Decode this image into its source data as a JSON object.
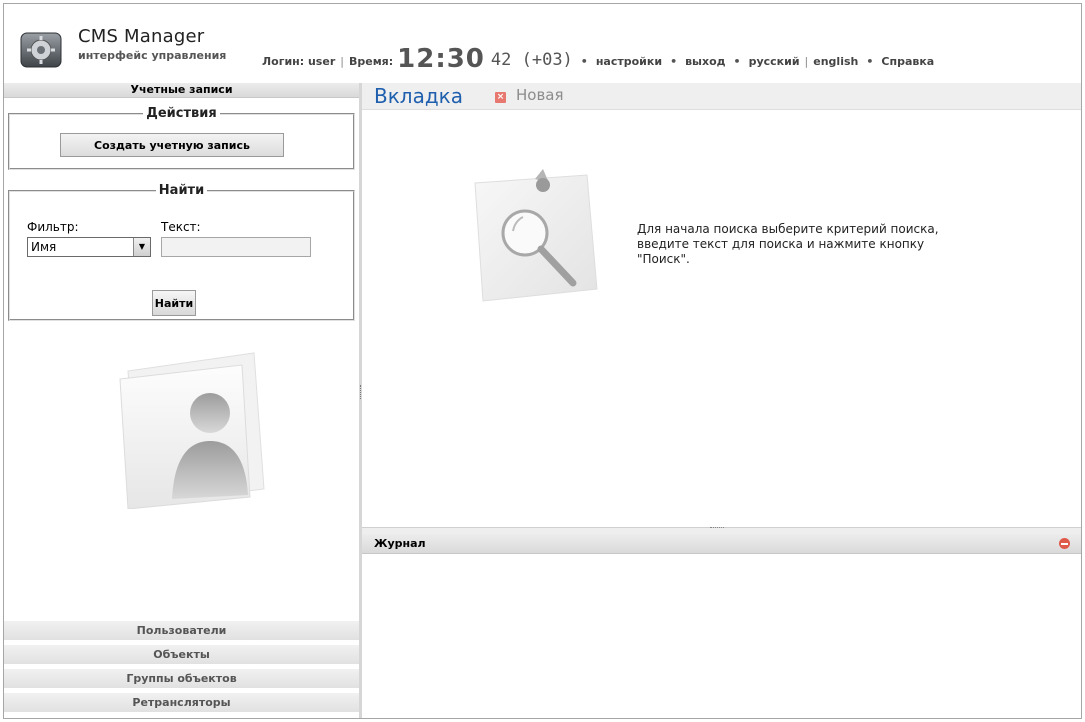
{
  "header": {
    "app_title": "CMS Manager",
    "app_subtitle": "интерфейс управления",
    "login_label": "Логин: user",
    "time_label": "Время:",
    "time_main": "12:30",
    "time_seconds": "42 (+03)",
    "links": {
      "settings": "настройки",
      "logout": "выход",
      "russian": "русский",
      "english": "english",
      "help": "Справка"
    }
  },
  "left": {
    "panel_title": "Учетные записи",
    "actions": {
      "legend": "Действия",
      "create_button": "Создать учетную запись"
    },
    "find": {
      "legend": "Найти",
      "filter_label": "Фильтр:",
      "text_label": "Текст:",
      "filter_value": "Имя",
      "text_value": "",
      "find_button": "Найти"
    },
    "nav": {
      "users": "Пользователи",
      "objects": "Объекты",
      "object_groups": "Группы объектов",
      "repeaters": "Ретрансляторы"
    }
  },
  "right": {
    "tab_active": "Вкладка",
    "tab_new": "Новая",
    "hint_text": "Для начала поиска выберите критерий поиска, введите текст для поиска и нажмите кнопку \"Поиск\".",
    "journal_title": "Журнал"
  },
  "colors": {
    "tab_accent": "#1f5fae",
    "close_red": "#e05a4c",
    "panel_gray": "#e5e5e5"
  }
}
